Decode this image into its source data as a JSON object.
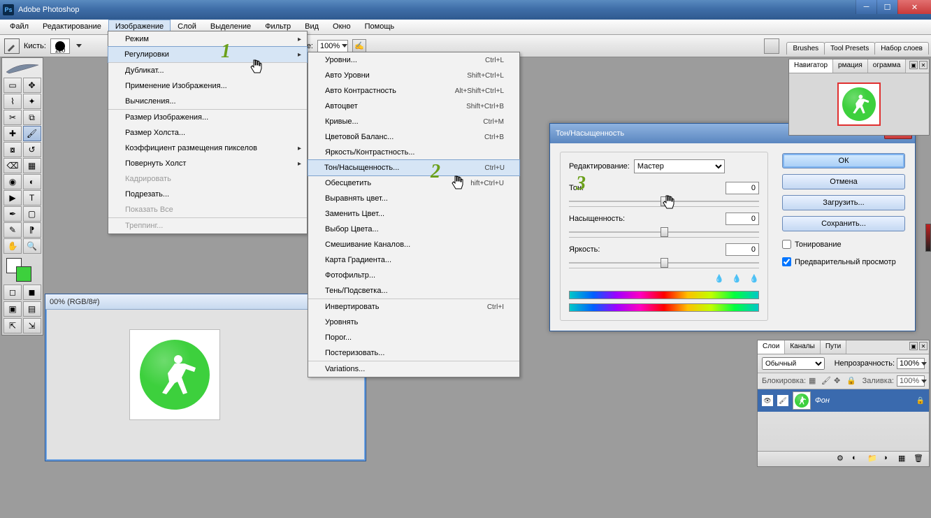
{
  "title": "Adobe Photoshop",
  "menubar": [
    "Файл",
    "Редактирование",
    "Изображение",
    "Слой",
    "Выделение",
    "Фильтр",
    "Вид",
    "Окно",
    "Помощь"
  ],
  "menubar_highlight_index": 2,
  "optionsbar": {
    "brush_label": "Кисть:",
    "brush_size": "120",
    "flow_label": "Течение:",
    "flow_value": "100%"
  },
  "right_tabs": [
    "Brushes",
    "Tool Presets",
    "Набор слоев"
  ],
  "doc_title": "00% (RGB/8#)",
  "menu_image": {
    "items": [
      {
        "label": "Режим",
        "sub": true
      },
      {
        "label": "Регулировки",
        "sub": true,
        "hover": true,
        "sep": true
      },
      {
        "label": "Дубликат...",
        "sep": true
      },
      {
        "label": "Применение Изображения..."
      },
      {
        "label": "Вычисления..."
      },
      {
        "label": "Размер Изображения...",
        "sep": true
      },
      {
        "label": "Размер Холста..."
      },
      {
        "label": "Коэффициент размещения пикселов",
        "sub": true
      },
      {
        "label": "Повернуть Холст",
        "sub": true
      },
      {
        "label": "Кадрировать",
        "disabled": true
      },
      {
        "label": "Подрезать..."
      },
      {
        "label": "Показать Все",
        "disabled": true
      },
      {
        "label": "Треппинг...",
        "disabled": true,
        "sep": true
      }
    ]
  },
  "menu_adjust": {
    "items": [
      {
        "label": "Уровни...",
        "sc": "Ctrl+L"
      },
      {
        "label": "Авто Уровни",
        "sc": "Shift+Ctrl+L"
      },
      {
        "label": "Авто Контрастность",
        "sc": "Alt+Shift+Ctrl+L"
      },
      {
        "label": "Автоцвет",
        "sc": "Shift+Ctrl+B"
      },
      {
        "label": "Кривые...",
        "sc": "Ctrl+M"
      },
      {
        "label": "Цветовой Баланс...",
        "sc": "Ctrl+B"
      },
      {
        "label": "Яркость/Контрастность..."
      },
      {
        "label": "Тон/Насыщенность...",
        "sc": "Ctrl+U",
        "hover": true,
        "sep": true
      },
      {
        "label": "Обесцветить",
        "sc": "hift+Ctrl+U"
      },
      {
        "label": "Выравнять цвет..."
      },
      {
        "label": "Заменить Цвет..."
      },
      {
        "label": "Выбор Цвета..."
      },
      {
        "label": "Смешивание Каналов..."
      },
      {
        "label": "Карта Градиента..."
      },
      {
        "label": "Фотофильтр..."
      },
      {
        "label": "Тень/Подсветка..."
      },
      {
        "label": "Инвертировать",
        "sc": "Ctrl+I",
        "sep": true
      },
      {
        "label": "Уровнять"
      },
      {
        "label": "Порог..."
      },
      {
        "label": "Постеризовать..."
      },
      {
        "label": "Variations...",
        "sep": true
      }
    ]
  },
  "dialog": {
    "title": "Тон/Насыщенность",
    "edit_label": "Редактирование:",
    "edit_value": "Мастер",
    "hue_label": "Тон:",
    "hue_value": "0",
    "sat_label": "Насыщенность:",
    "sat_value": "0",
    "light_label": "Яркость:",
    "light_value": "0",
    "ok": "OК",
    "cancel": "Отмена",
    "load": "Загрузить...",
    "save": "Сохранить...",
    "colorize": "Тонирование",
    "preview": "Предварительный просмотр",
    "preview_checked": true
  },
  "navigator": {
    "tabs": [
      "Навигатор",
      "рмация",
      "ограмма"
    ]
  },
  "layers": {
    "tabs": [
      "Слои",
      "Каналы",
      "Пути"
    ],
    "blend": "Обычный",
    "opacity_label": "Непрозрачность:",
    "opacity": "100%",
    "lock_label": "Блокировка:",
    "fill_label": "Заливка:",
    "fill": "100%",
    "layer_name": "Фон"
  },
  "annotations": {
    "a1": "1",
    "a2": "2",
    "a3": "3"
  }
}
